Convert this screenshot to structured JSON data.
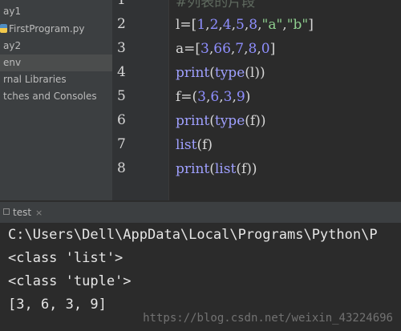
{
  "sidebar": {
    "items": [
      {
        "label": "ay1"
      },
      {
        "label": "FirstProgram.py"
      },
      {
        "label": "ay2"
      },
      {
        "label": "env"
      },
      {
        "label": "rnal Libraries"
      },
      {
        "label": "tches and Consoles"
      }
    ]
  },
  "editor": {
    "line_numbers": [
      "1",
      "2",
      "3",
      "4",
      "5",
      "6",
      "7",
      "8"
    ],
    "lines": [
      "#列表的片段",
      "l=[1,2,4,5,8,\"a\",\"b\"]",
      "a=[3,66,7,8,0]",
      "print(type(l))",
      "f=(3,6,3,9)",
      "print(type(f))",
      "list(f)",
      "print(list(f))"
    ]
  },
  "run": {
    "tab_label": "test",
    "close_glyph": "×",
    "output": [
      "C:\\Users\\Dell\\AppData\\Local\\Programs\\Python\\P",
      "<class 'list'>",
      "<class 'tuple'>",
      "[3, 6, 3, 9]"
    ]
  },
  "watermark": "https://blog.csdn.net/weixin_43224696",
  "colors": {
    "sidebar_bg": "#3c3f41",
    "editor_bg": "#2b2b2b",
    "number": "#8f8fff",
    "string": "#8fd08f"
  }
}
